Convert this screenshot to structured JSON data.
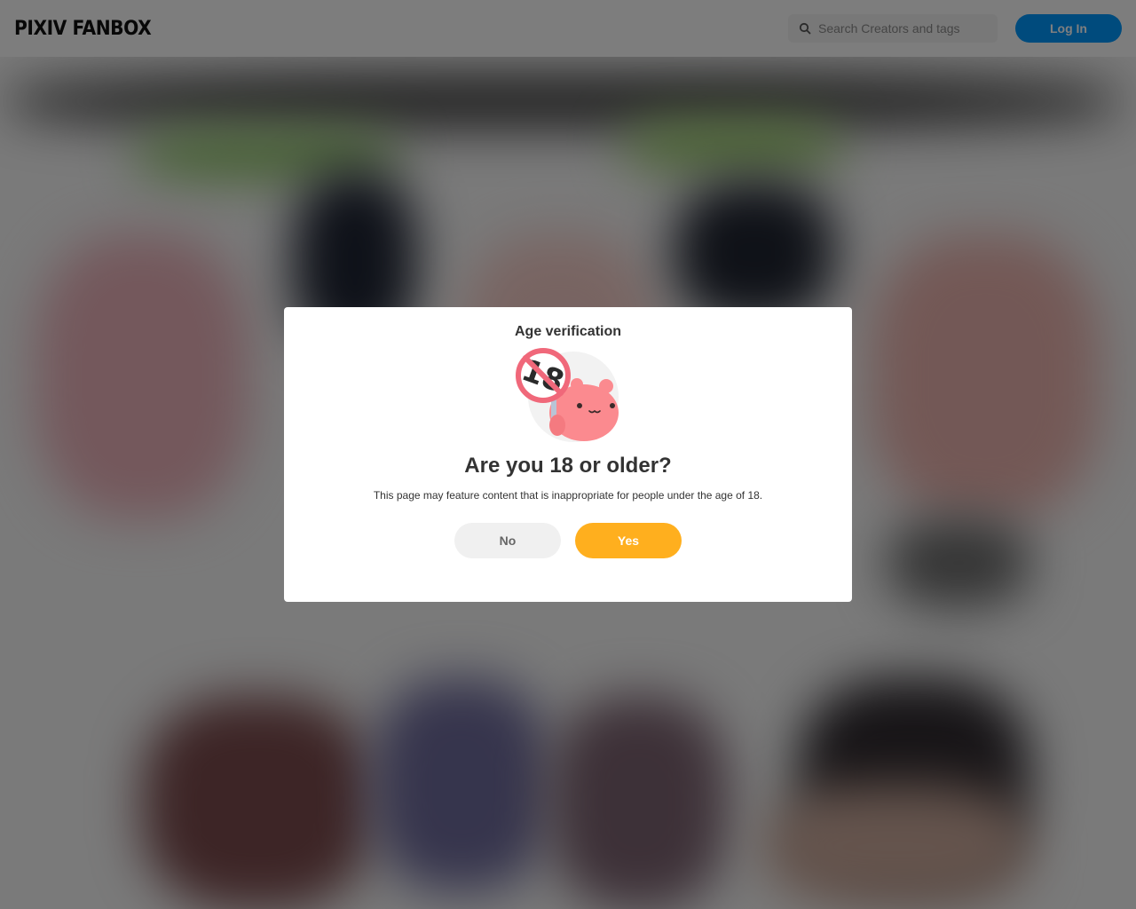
{
  "header": {
    "logo": "PIXIV FANBOX",
    "search_placeholder": "Search Creators and tags",
    "login_label": "Log In"
  },
  "modal": {
    "title": "Age verification",
    "mascot_sign_text": "18",
    "question": "Are you 18 or older?",
    "description": "This page may feature content that is inappropriate for people under the age of 18.",
    "no_label": "No",
    "yes_label": "Yes"
  },
  "colors": {
    "login_button": "#0096fa",
    "yes_button": "#ffaf1e",
    "no_button": "#f0f0f0",
    "overlay": "rgba(0,0,0,0.5)",
    "mascot_pink": "#fb8a8f",
    "prohibition_red": "#f0687a"
  },
  "icons": {
    "search": "search-icon",
    "mascot": "age-restriction-mascot-icon"
  }
}
